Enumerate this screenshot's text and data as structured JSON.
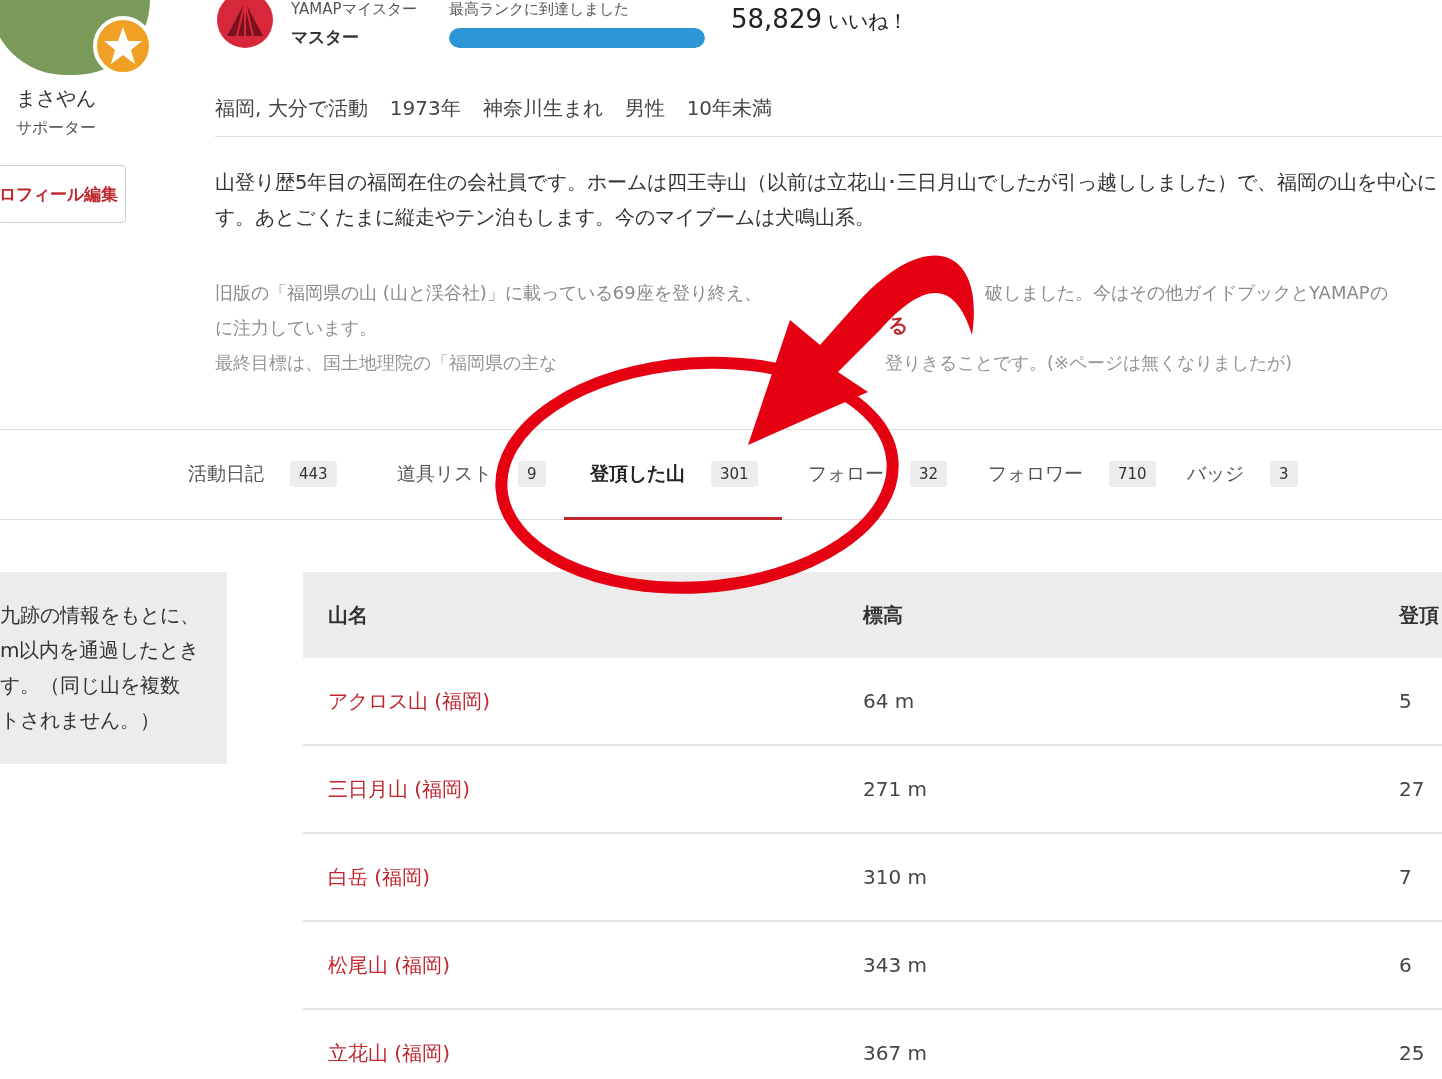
{
  "profile": {
    "name": "まさやん",
    "role": "サポーター",
    "edit_button": "ロフィール編集"
  },
  "rank": {
    "title": "YAMAPマイスター",
    "level_name": "マスター",
    "message": "最高ランクに到達しました",
    "level": 1
  },
  "likes": {
    "count": "58,829",
    "label": "いいね！"
  },
  "facts": [
    "福岡, 大分で活動",
    "1973年",
    "神奈川生まれ",
    "男性",
    "10年未満"
  ],
  "bio": [
    "山登り歴5年目の福岡在住の会社員です。ホームは四王寺山（以前は立花山･三日月山でしたが引っ越ししました）で、福岡の山を中心に",
    "す。あとごくたまに縦走やテン泊もします。今のマイブームは犬鳴山系。"
  ],
  "bio_faded": [
    "旧版の「福岡県の山 (山と渓谷社)」に載っている69座を登り終え、",
    "破しました。今はその他ガイドブックとYAMAPの",
    "に注力しています。",
    "最終目標は、国土地理院の「福岡県の主な",
    "登りきることです。(※ページは無くなりましたが)"
  ],
  "more_link": "る",
  "tabs": [
    {
      "label": "活動日記",
      "count": "443",
      "selected": false
    },
    {
      "label": "道具リスト",
      "count": "9",
      "selected": false
    },
    {
      "label": "登頂した山",
      "count": "301",
      "selected": true
    },
    {
      "label": "フォロー",
      "count": "32",
      "selected": false
    },
    {
      "label": "フォロワー",
      "count": "710",
      "selected": false
    },
    {
      "label": "バッジ",
      "count": "3",
      "selected": false
    }
  ],
  "note_lines": [
    "九跡の情報をもとに、",
    "m以内を通過したとき",
    "す。（同じ山を複数",
    "トされません。）"
  ],
  "table": {
    "columns": [
      "山名",
      "標高",
      "登頂"
    ],
    "rows": [
      [
        "アクロス山 (福岡)",
        "64 m",
        "5"
      ],
      [
        "三日月山 (福岡)",
        "271 m",
        "27"
      ],
      [
        "白岳 (福岡)",
        "310 m",
        "7"
      ],
      [
        "松尾山 (福岡)",
        "343 m",
        "6"
      ],
      [
        "立花山 (福岡)",
        "367 m",
        "25"
      ]
    ]
  }
}
